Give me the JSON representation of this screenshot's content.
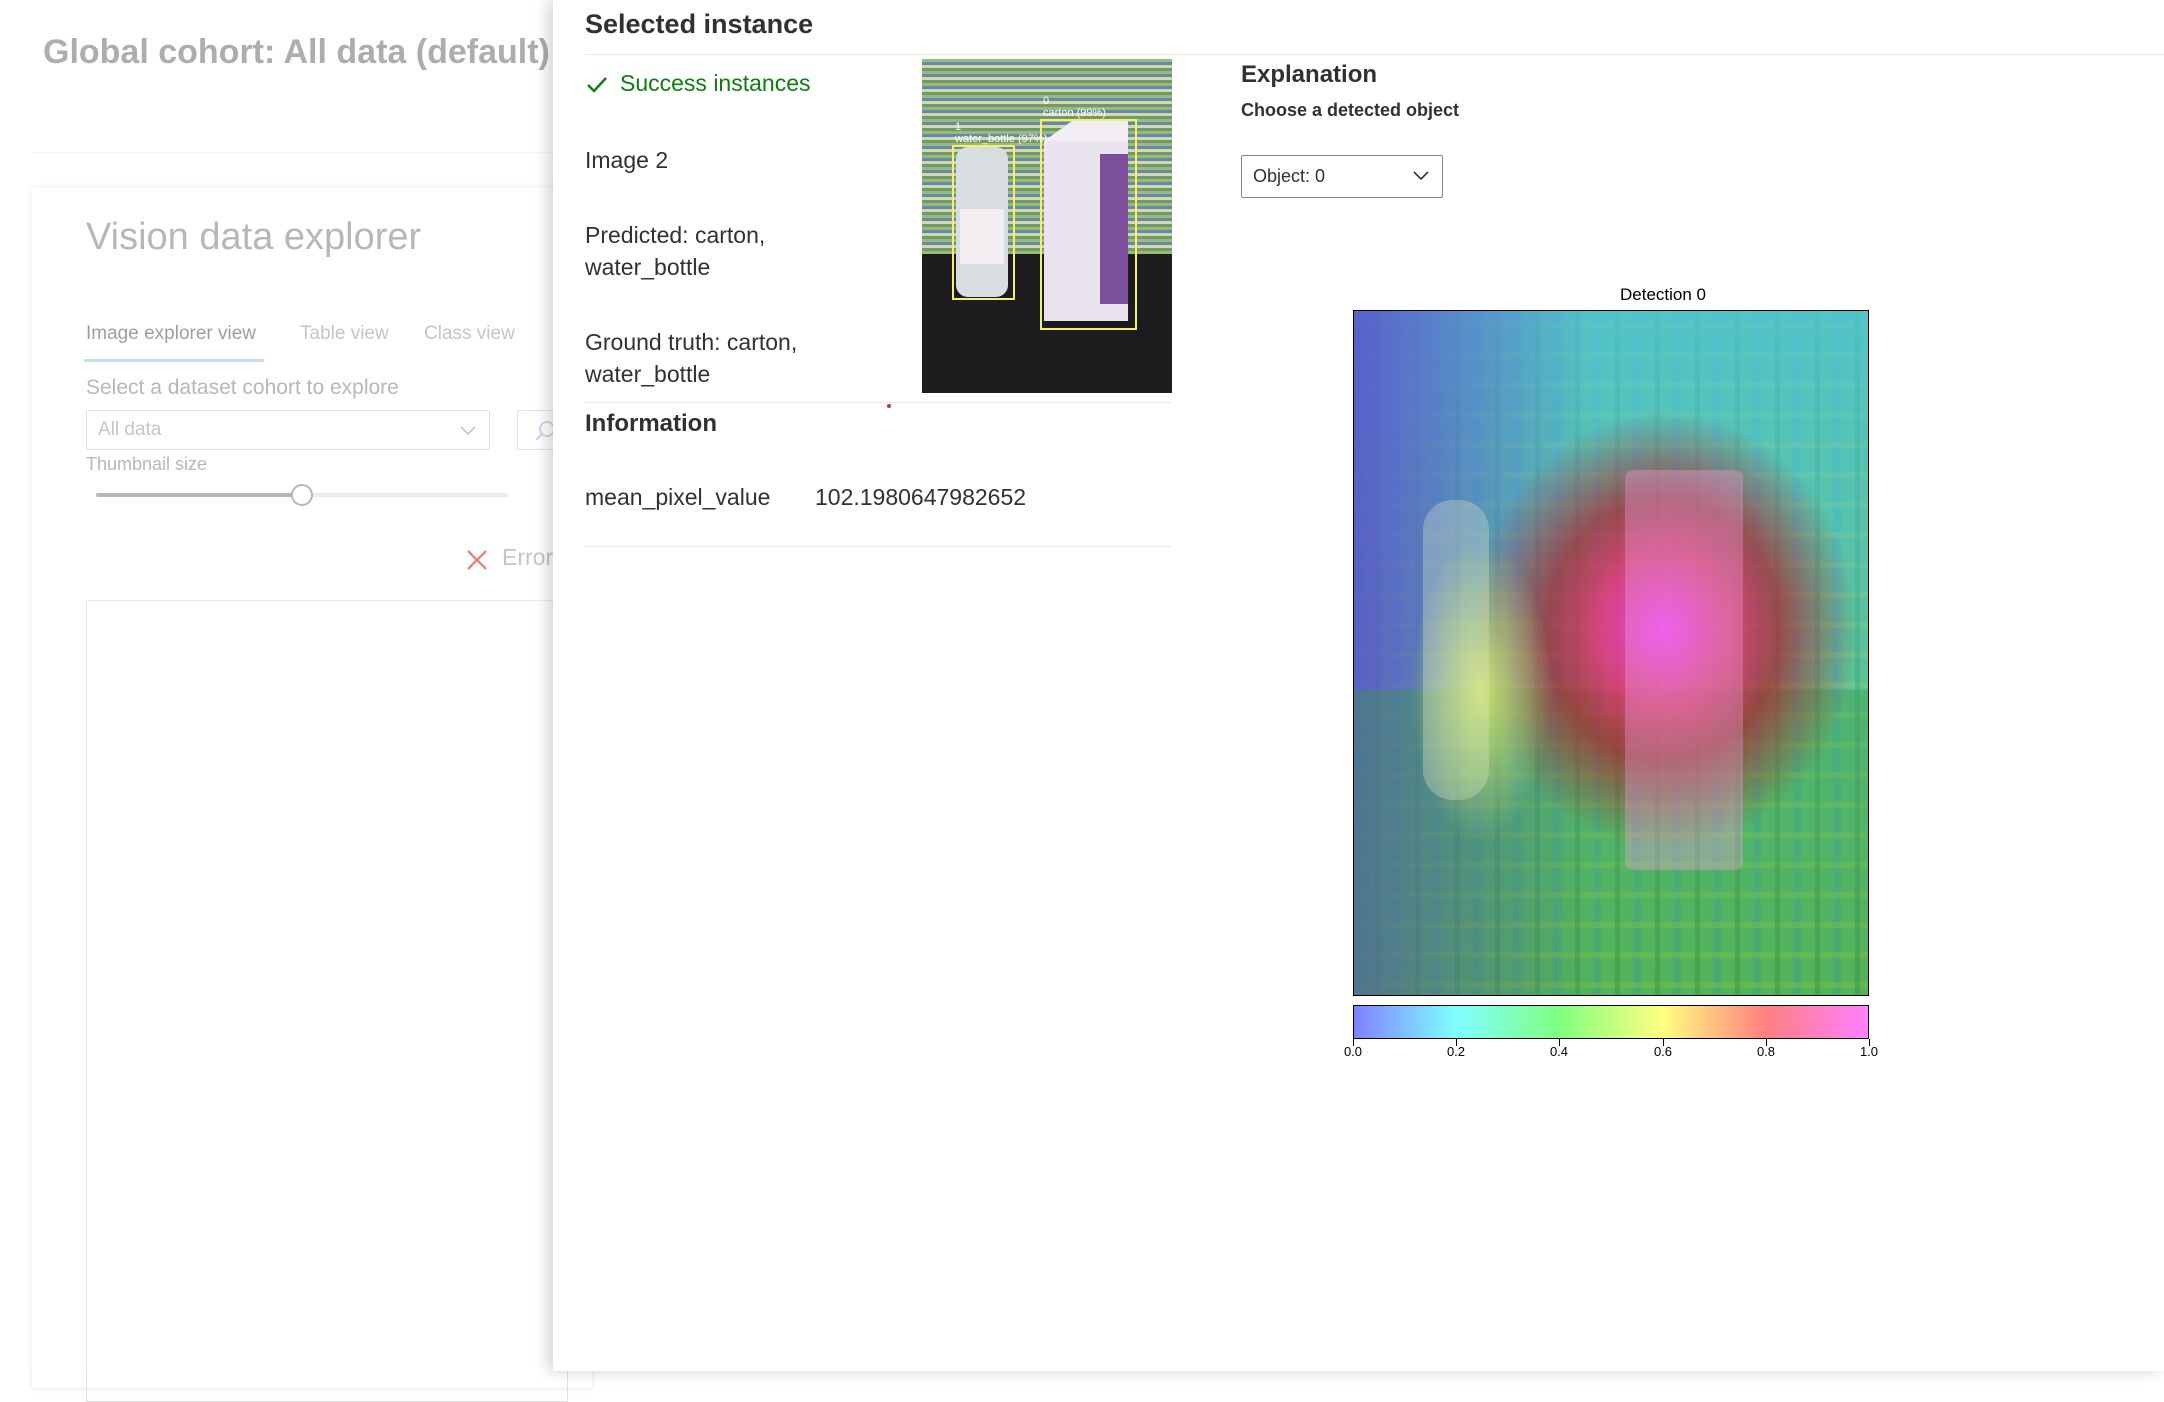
{
  "background": {
    "cohort_title": "Global cohort: All data (default)",
    "explorer_title": "Vision data explorer",
    "tabs": [
      {
        "label": "Image explorer view",
        "active": true
      },
      {
        "label": "Table view",
        "active": false
      },
      {
        "label": "Class view",
        "active": false
      }
    ],
    "cohort_select_label": "Select a dataset cohort to explore",
    "cohort_select_value": "All data",
    "thumbnail_size_label": "Thumbnail size",
    "thumbnail_slider_fraction": 0.5,
    "error_text": "Error"
  },
  "panel": {
    "title": "Selected instance",
    "status": "Success instances",
    "status_color": "#107c10",
    "image_label": "Image 2",
    "predicted_line1": "Predicted: carton,",
    "predicted_line2": "water_bottle",
    "ground_truth_line1": "Ground truth: carton,",
    "ground_truth_line2": "water_bottle",
    "information_heading": "Information",
    "info_key": "mean_pixel_value",
    "info_value": "102.1980647982652",
    "thumbnail_boxes": [
      {
        "id": "0",
        "label": "carton (99%)"
      },
      {
        "id": "1",
        "label": "water_bottle (97%)"
      }
    ]
  },
  "explanation": {
    "heading": "Explanation",
    "choose_label": "Choose a detected object",
    "selected_object": "Object: 0",
    "heatmap_title": "Detection 0",
    "colorbar_ticks": [
      "0.0",
      "0.2",
      "0.4",
      "0.6",
      "0.8",
      "1.0"
    ]
  }
}
